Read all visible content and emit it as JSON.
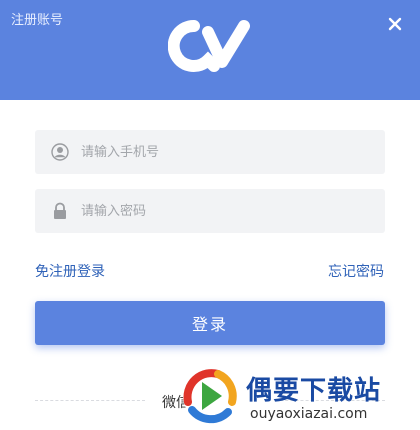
{
  "header": {
    "register_label": "注册账号",
    "background_color": "#5b83df",
    "logo_icon": "qv-logo-icon",
    "close_icon": "close-icon"
  },
  "form": {
    "phone_placeholder": "请输入手机号",
    "phone_icon": "user-icon",
    "password_placeholder": "请输入密码",
    "password_icon": "lock-icon",
    "free_register_login": "免注册登录",
    "forgot_password": "忘记密码",
    "login_button": "登录",
    "accent_color": "#5b83df"
  },
  "footer": {
    "wechat_login": "微信登录"
  },
  "watermark": {
    "brand": "偶要下载站",
    "url": "ouyaoxiazai.com"
  }
}
